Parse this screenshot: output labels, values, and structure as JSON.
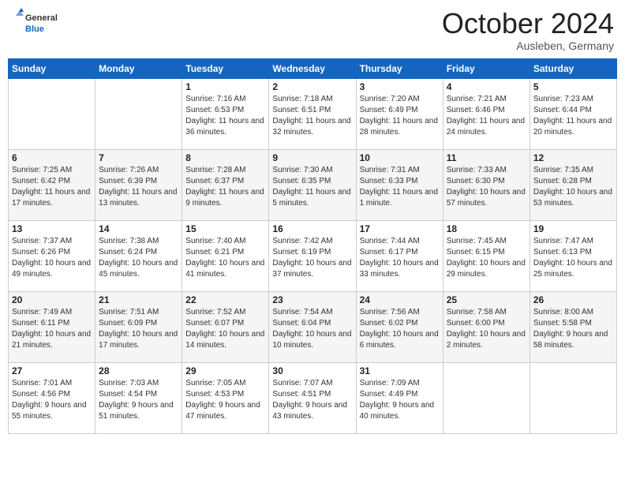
{
  "header": {
    "logo": {
      "general": "General",
      "blue": "Blue"
    },
    "month": "October 2024",
    "location": "Ausleben, Germany"
  },
  "weekdays": [
    "Sunday",
    "Monday",
    "Tuesday",
    "Wednesday",
    "Thursday",
    "Friday",
    "Saturday"
  ],
  "weeks": [
    [
      {
        "day": null
      },
      {
        "day": null
      },
      {
        "day": 1,
        "sunrise": "7:16 AM",
        "sunset": "6:53 PM",
        "daylight": "11 hours and 36 minutes."
      },
      {
        "day": 2,
        "sunrise": "7:18 AM",
        "sunset": "6:51 PM",
        "daylight": "11 hours and 32 minutes."
      },
      {
        "day": 3,
        "sunrise": "7:20 AM",
        "sunset": "6:49 PM",
        "daylight": "11 hours and 28 minutes."
      },
      {
        "day": 4,
        "sunrise": "7:21 AM",
        "sunset": "6:46 PM",
        "daylight": "11 hours and 24 minutes."
      },
      {
        "day": 5,
        "sunrise": "7:23 AM",
        "sunset": "6:44 PM",
        "daylight": "11 hours and 20 minutes."
      }
    ],
    [
      {
        "day": 6,
        "sunrise": "7:25 AM",
        "sunset": "6:42 PM",
        "daylight": "11 hours and 17 minutes."
      },
      {
        "day": 7,
        "sunrise": "7:26 AM",
        "sunset": "6:39 PM",
        "daylight": "11 hours and 13 minutes."
      },
      {
        "day": 8,
        "sunrise": "7:28 AM",
        "sunset": "6:37 PM",
        "daylight": "11 hours and 9 minutes."
      },
      {
        "day": 9,
        "sunrise": "7:30 AM",
        "sunset": "6:35 PM",
        "daylight": "11 hours and 5 minutes."
      },
      {
        "day": 10,
        "sunrise": "7:31 AM",
        "sunset": "6:33 PM",
        "daylight": "11 hours and 1 minute."
      },
      {
        "day": 11,
        "sunrise": "7:33 AM",
        "sunset": "6:30 PM",
        "daylight": "10 hours and 57 minutes."
      },
      {
        "day": 12,
        "sunrise": "7:35 AM",
        "sunset": "6:28 PM",
        "daylight": "10 hours and 53 minutes."
      }
    ],
    [
      {
        "day": 13,
        "sunrise": "7:37 AM",
        "sunset": "6:26 PM",
        "daylight": "10 hours and 49 minutes."
      },
      {
        "day": 14,
        "sunrise": "7:38 AM",
        "sunset": "6:24 PM",
        "daylight": "10 hours and 45 minutes."
      },
      {
        "day": 15,
        "sunrise": "7:40 AM",
        "sunset": "6:21 PM",
        "daylight": "10 hours and 41 minutes."
      },
      {
        "day": 16,
        "sunrise": "7:42 AM",
        "sunset": "6:19 PM",
        "daylight": "10 hours and 37 minutes."
      },
      {
        "day": 17,
        "sunrise": "7:44 AM",
        "sunset": "6:17 PM",
        "daylight": "10 hours and 33 minutes."
      },
      {
        "day": 18,
        "sunrise": "7:45 AM",
        "sunset": "6:15 PM",
        "daylight": "10 hours and 29 minutes."
      },
      {
        "day": 19,
        "sunrise": "7:47 AM",
        "sunset": "6:13 PM",
        "daylight": "10 hours and 25 minutes."
      }
    ],
    [
      {
        "day": 20,
        "sunrise": "7:49 AM",
        "sunset": "6:11 PM",
        "daylight": "10 hours and 21 minutes."
      },
      {
        "day": 21,
        "sunrise": "7:51 AM",
        "sunset": "6:09 PM",
        "daylight": "10 hours and 17 minutes."
      },
      {
        "day": 22,
        "sunrise": "7:52 AM",
        "sunset": "6:07 PM",
        "daylight": "10 hours and 14 minutes."
      },
      {
        "day": 23,
        "sunrise": "7:54 AM",
        "sunset": "6:04 PM",
        "daylight": "10 hours and 10 minutes."
      },
      {
        "day": 24,
        "sunrise": "7:56 AM",
        "sunset": "6:02 PM",
        "daylight": "10 hours and 6 minutes."
      },
      {
        "day": 25,
        "sunrise": "7:58 AM",
        "sunset": "6:00 PM",
        "daylight": "10 hours and 2 minutes."
      },
      {
        "day": 26,
        "sunrise": "8:00 AM",
        "sunset": "5:58 PM",
        "daylight": "9 hours and 58 minutes."
      }
    ],
    [
      {
        "day": 27,
        "sunrise": "7:01 AM",
        "sunset": "4:56 PM",
        "daylight": "9 hours and 55 minutes."
      },
      {
        "day": 28,
        "sunrise": "7:03 AM",
        "sunset": "4:54 PM",
        "daylight": "9 hours and 51 minutes."
      },
      {
        "day": 29,
        "sunrise": "7:05 AM",
        "sunset": "4:53 PM",
        "daylight": "9 hours and 47 minutes."
      },
      {
        "day": 30,
        "sunrise": "7:07 AM",
        "sunset": "4:51 PM",
        "daylight": "9 hours and 43 minutes."
      },
      {
        "day": 31,
        "sunrise": "7:09 AM",
        "sunset": "4:49 PM",
        "daylight": "9 hours and 40 minutes."
      },
      {
        "day": null
      },
      {
        "day": null
      }
    ]
  ]
}
